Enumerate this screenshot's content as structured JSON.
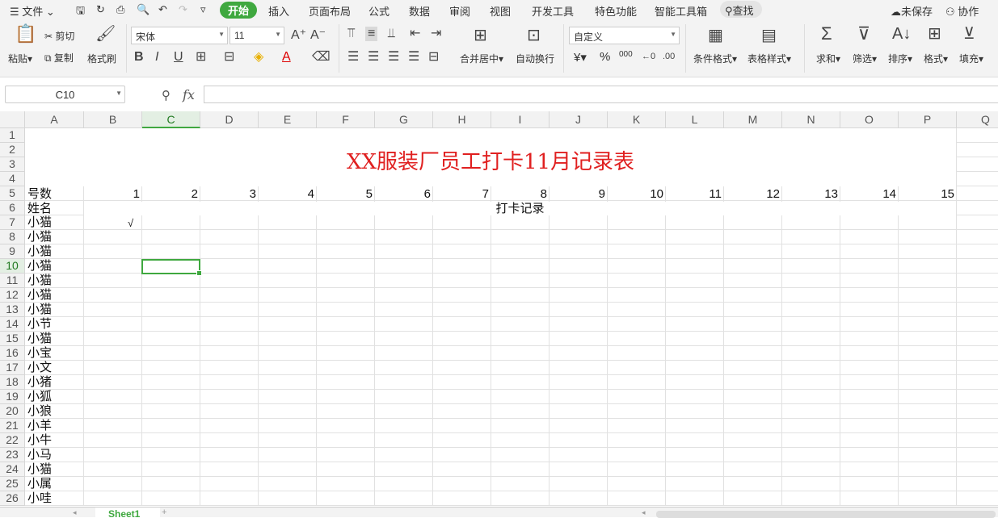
{
  "menu": {
    "file": "文件",
    "tabs": [
      "开始",
      "插入",
      "页面布局",
      "公式",
      "数据",
      "审阅",
      "视图",
      "开发工具",
      "特色功能",
      "智能工具箱"
    ],
    "search": "查找",
    "unsaved": "未保存",
    "collab": "协作"
  },
  "ribbon": {
    "cut": "剪切",
    "copy": "复制",
    "paste": "粘贴",
    "format_painter": "格式刷",
    "font_name": "宋体",
    "font_size": "11",
    "merge_center": "合并居中",
    "wrap_text": "自动换行",
    "number_format": "自定义",
    "currency": "¥",
    "percent": "%",
    "thousands": "000",
    "conditional_format": "条件格式",
    "table_style": "表格样式",
    "sum": "求和",
    "filter": "筛选",
    "sort": "排序",
    "format": "格式",
    "fill": "填充"
  },
  "formula_bar": {
    "name_box": "C10",
    "fx": "fx",
    "content": ""
  },
  "grid": {
    "columns": [
      "A",
      "B",
      "C",
      "D",
      "E",
      "F",
      "G",
      "H",
      "I",
      "J",
      "K",
      "L",
      "M",
      "N",
      "O",
      "P",
      "Q"
    ],
    "rows": [
      "1",
      "2",
      "3",
      "4",
      "5",
      "6",
      "7",
      "8",
      "9",
      "10",
      "11",
      "12",
      "13",
      "14",
      "15",
      "16",
      "17",
      "18",
      "19",
      "20",
      "21",
      "22",
      "23",
      "24",
      "25",
      "26"
    ],
    "selected_column": "C",
    "selected_row": "10",
    "title": "XX服装厂员工打卡11月记录表",
    "label_number": "号数",
    "label_name": "姓名",
    "day_numbers": [
      "1",
      "2",
      "3",
      "4",
      "5",
      "6",
      "7",
      "8",
      "9",
      "10",
      "11",
      "12",
      "13",
      "14",
      "15"
    ],
    "punch_header": "打卡记录",
    "check_mark": "√",
    "names": [
      "小猫",
      "小猫",
      "小猫",
      "小猫",
      "小猫",
      "小猫",
      "小猫",
      "小节",
      "小猫",
      "小宝",
      "小文",
      "小猪",
      "小狐",
      "小狼",
      "小羊",
      "小牛",
      "小马",
      "小猫",
      "小属",
      "小哇"
    ]
  },
  "sheets": [
    "Sheet1"
  ],
  "colors": {
    "accent": "#3fa83f",
    "title": "#e02020"
  }
}
